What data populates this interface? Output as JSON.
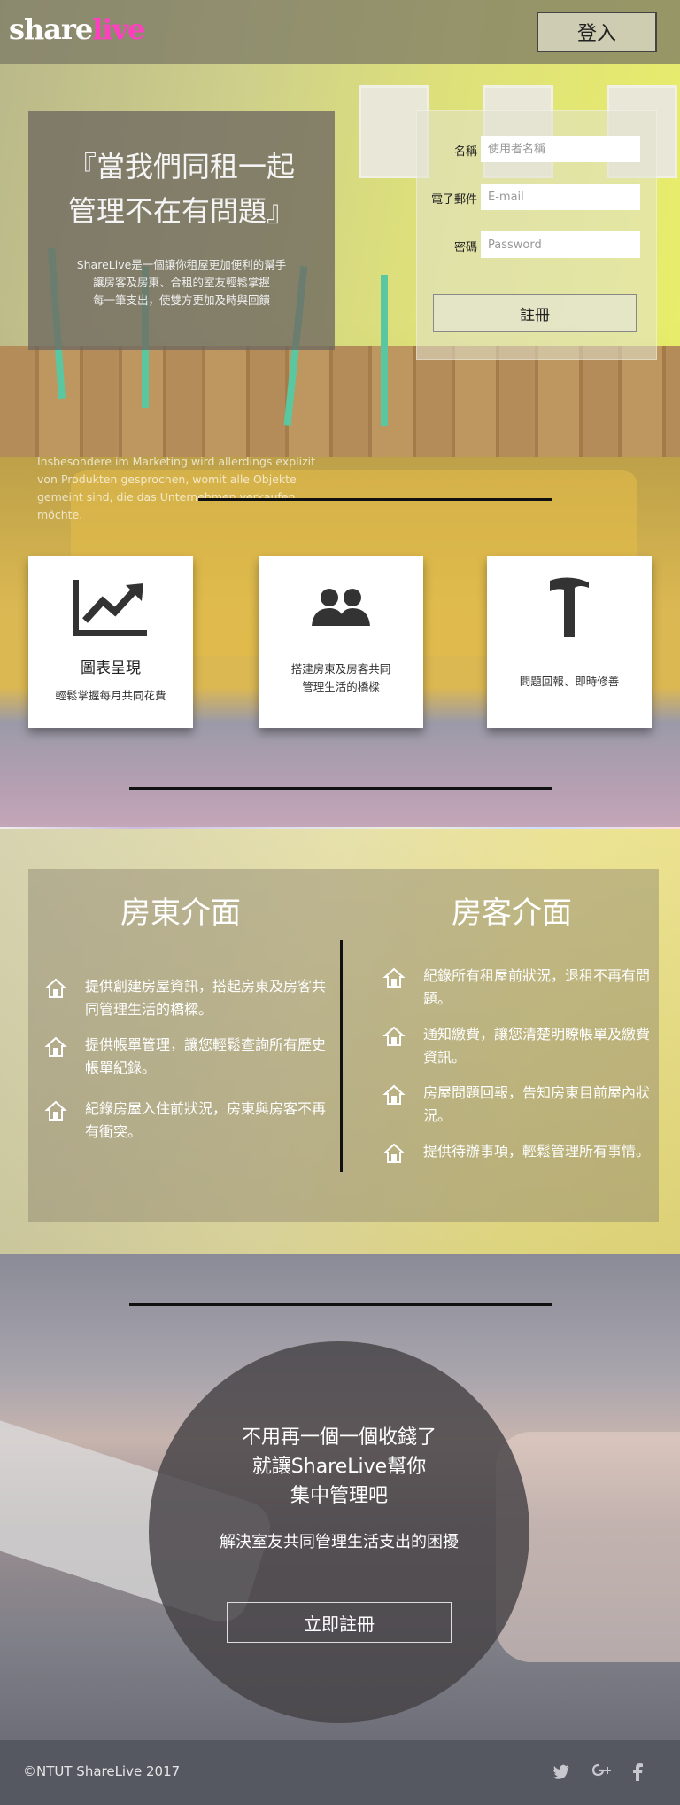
{
  "header": {
    "logo_part1": "share",
    "logo_part2": "live",
    "login_label": "登入"
  },
  "hero": {
    "quote_line1": "『當我們同租一起",
    "quote_line2": "管理不在有問題』",
    "desc_line1": "ShareLive是一個讓你租屋更加便利的幫手",
    "desc_line2": "讓房客及房東、合租的室友輕鬆掌握",
    "desc_line3": "每一筆支出，使雙方更加及時與回饋"
  },
  "signup_form": {
    "name_label": "名稱",
    "name_placeholder": "使用者名稱",
    "email_label": "電子郵件",
    "email_placeholder": "E-mail",
    "password_label": "密碼",
    "password_placeholder": "Password",
    "submit_label": "註冊"
  },
  "features": {
    "faded_text_line1": "Insbesondere im Marketing wird allerdings explizit",
    "faded_text_line2": "von Produkten gesprochen, womit alle Objekte",
    "faded_text_line3": "gemeint sind, die das Unternehmen verkaufen",
    "faded_text_line4": "möchte.",
    "cards": [
      {
        "icon": "chart-line-icon",
        "title": "圖表呈現",
        "desc": "輕鬆掌握每月共同花費"
      },
      {
        "icon": "users-icon",
        "desc_line1": "搭建房東及房客共同",
        "desc_line2": "管理生活的橋樑"
      },
      {
        "icon": "hammer-icon",
        "desc": "問題回報、即時修善"
      }
    ]
  },
  "interfaces": {
    "landlord": {
      "title": "房東介面",
      "items": [
        "提供創建房屋資訊，搭起房東及房客共同管理生活的橋樑。",
        "提供帳單管理，讓您輕鬆查詢所有歷史帳單紀錄。",
        "紀錄房屋入住前狀況，房東與房客不再有衝突。"
      ]
    },
    "tenant": {
      "title": "房客介面",
      "items": [
        "紀錄所有租屋前狀況，退租不再有問題。",
        "通知繳費，讓您清楚明瞭帳單及繳費資訊。",
        "房屋問題回報，告知房東目前屋內狀況。",
        "提供待辦事項，輕鬆管理所有事情。"
      ]
    }
  },
  "cta": {
    "headline_line1": "不用再一個一個收錢了",
    "headline_line2": "就讓ShareLive幫你",
    "headline_line3": "集中管理吧",
    "subtext": "解決室友共同管理生活支出的困擾",
    "button_label": "立即註冊"
  },
  "footer": {
    "copyright": "©NTUT ShareLive 2017",
    "social": [
      "twitter-icon",
      "google-plus-icon",
      "facebook-icon"
    ]
  }
}
